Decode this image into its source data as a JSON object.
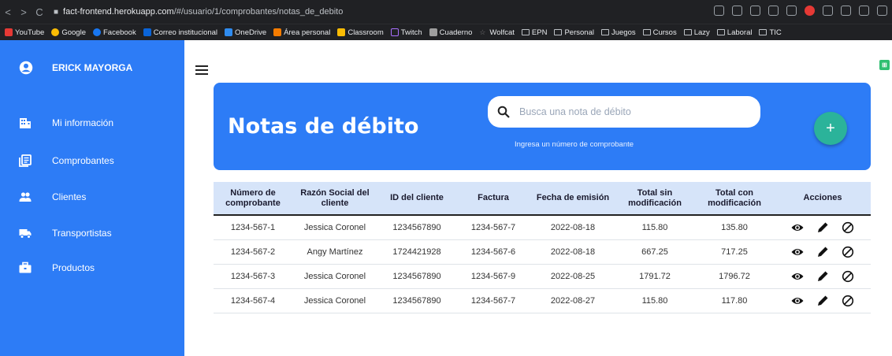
{
  "browser": {
    "url_host": "fact-frontend.herokuapp.com",
    "url_path": "/#/usuario/1/comprobantes/notas_de_debito",
    "bookmarks": [
      "YouTube",
      "Google",
      "Facebook",
      "Correo institucional",
      "OneDrive",
      "Área personal",
      "Classroom",
      "Twitch",
      "Cuaderno",
      "Wolfcat",
      "EPN",
      "Personal",
      "Juegos",
      "Cursos",
      "Lazy",
      "Laboral",
      "TIC"
    ]
  },
  "sidebar": {
    "user_name": "ERICK MAYORGA",
    "items": [
      {
        "label": "Mi información"
      },
      {
        "label": "Comprobantes"
      },
      {
        "label": "Clientes"
      },
      {
        "label": "Transportistas"
      },
      {
        "label": "Productos"
      }
    ]
  },
  "header": {
    "title": "Notas de débito",
    "search_placeholder": "Busca una nota de débito",
    "search_hint": "Ingresa un número de comprobante",
    "add_label": "+"
  },
  "table": {
    "columns": [
      "Número de comprobante",
      "Razón Social del cliente",
      "ID del cliente",
      "Factura",
      "Fecha de emisión",
      "Total sin modificación",
      "Total con modificación",
      "Acciones"
    ],
    "rows": [
      [
        "1234-567-1",
        "Jessica Coronel",
        "1234567890",
        "1234-567-7",
        "2022-08-18",
        "115.80",
        "135.80"
      ],
      [
        "1234-567-2",
        "Angy Martínez",
        "1724421928",
        "1234-567-6",
        "2022-08-18",
        "667.25",
        "717.25"
      ],
      [
        "1234-567-3",
        "Jessica Coronel",
        "1234567890",
        "1234-567-9",
        "2022-08-25",
        "1791.72",
        "1796.72"
      ],
      [
        "1234-567-4",
        "Jessica Coronel",
        "1234567890",
        "1234-567-7",
        "2022-08-27",
        "115.80",
        "117.80"
      ]
    ]
  },
  "colors": {
    "primary": "#2d7cf6",
    "add_button": "#2bb39a",
    "table_header": "#d6e4f9"
  }
}
